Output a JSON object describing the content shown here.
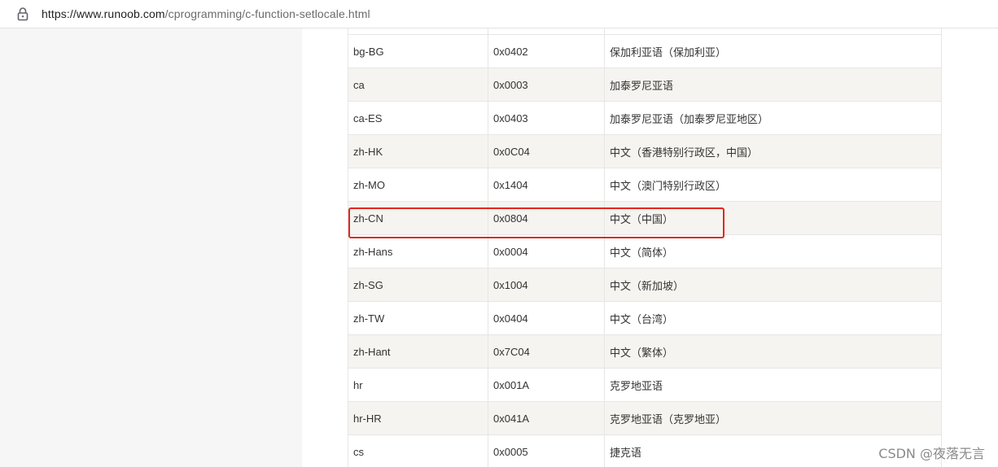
{
  "browser": {
    "url_host": "https://www.runoob.com",
    "url_path": "/cprogramming/c-function-setlocale.html",
    "lock_icon": "lock-icon"
  },
  "table": {
    "rows": [
      {
        "tag": "bg-BG",
        "code": "0x0402",
        "name": "保加利亚语（保加利亚）"
      },
      {
        "tag": "ca",
        "code": "0x0003",
        "name": "加泰罗尼亚语"
      },
      {
        "tag": "ca-ES",
        "code": "0x0403",
        "name": "加泰罗尼亚语（加泰罗尼亚地区）"
      },
      {
        "tag": "zh-HK",
        "code": "0x0C04",
        "name": "中文（香港特别行政区，中国）"
      },
      {
        "tag": "zh-MO",
        "code": "0x1404",
        "name": "中文（澳门特别行政区）"
      },
      {
        "tag": "zh-CN",
        "code": "0x0804",
        "name": "中文（中国）"
      },
      {
        "tag": "zh-Hans",
        "code": "0x0004",
        "name": "中文（简体）"
      },
      {
        "tag": "zh-SG",
        "code": "0x1004",
        "name": "中文（新加坡）"
      },
      {
        "tag": "zh-TW",
        "code": "0x0404",
        "name": "中文（台湾）"
      },
      {
        "tag": "zh-Hant",
        "code": "0x7C04",
        "name": "中文（繁体）"
      },
      {
        "tag": "hr",
        "code": "0x001A",
        "name": "克罗地亚语"
      },
      {
        "tag": "hr-HR",
        "code": "0x041A",
        "name": "克罗地亚语（克罗地亚）"
      },
      {
        "tag": "cs",
        "code": "0x0005",
        "name": "捷克语"
      }
    ]
  },
  "highlight": {
    "row_tag": "zh-CN",
    "color": "#e3261c"
  },
  "watermark": "CSDN @夜落无言"
}
